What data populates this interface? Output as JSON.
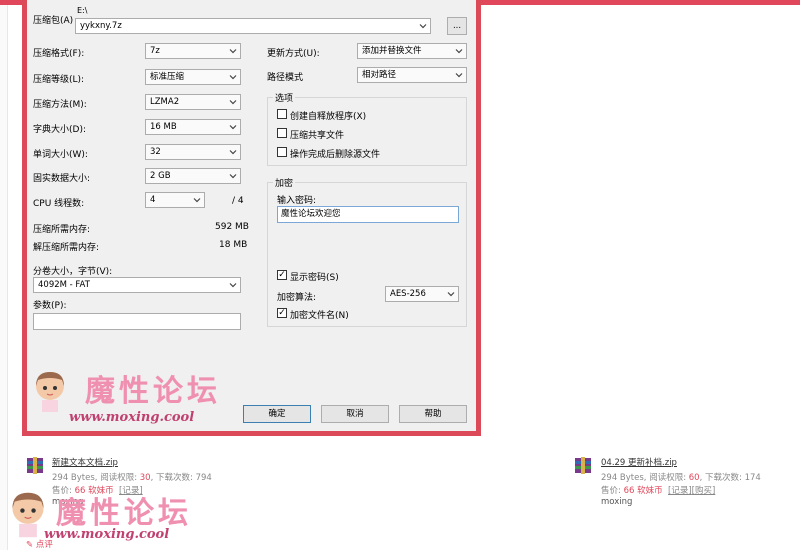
{
  "colors": {
    "accent": "#e0475a",
    "dialog_bg": "#f0f0f0",
    "watermark_pink": "#f090b0"
  },
  "archive": {
    "label": "压缩包(A)",
    "path_hint": "E:\\",
    "name_value": "yykxny.7z",
    "browse_label": "..."
  },
  "left": {
    "format": {
      "label": "压缩格式(F):",
      "value": "7z"
    },
    "level": {
      "label": "压缩等级(L):",
      "value": "标准压缩"
    },
    "method": {
      "label": "压缩方法(M):",
      "value": "LZMA2"
    },
    "dict": {
      "label": "字典大小(D):",
      "value": "16 MB"
    },
    "word": {
      "label": "单词大小(W):",
      "value": "32"
    },
    "solid": {
      "label": "固实数据大小:",
      "value": "2 GB"
    },
    "cpu": {
      "label": "CPU 线程数:",
      "value": "4",
      "total": "/ 4"
    },
    "mem_compress": {
      "label": "压缩所需内存:",
      "value": "592 MB"
    },
    "mem_decompress": {
      "label": "解压缩所需内存:",
      "value": "18 MB"
    },
    "volume": {
      "label": "分卷大小，字节(V):",
      "value": "4092M - FAT"
    },
    "params": {
      "label": "参数(P):",
      "value": ""
    }
  },
  "right": {
    "update": {
      "label": "更新方式(U):",
      "value": "添加并替换文件"
    },
    "path_mode": {
      "label": "路径模式",
      "value": "相对路径"
    },
    "options": {
      "title": "选项",
      "sfx": "创建自释放程序(X)",
      "shared": "压缩共享文件",
      "delete": "操作完成后删除源文件"
    },
    "encrypt": {
      "title": "加密",
      "pw_label": "输入密码:",
      "pw_value": "魔性论坛欢迎您",
      "show_pw": "显示密码(S)",
      "algo_label": "加密算法:",
      "algo_value": "AES-256",
      "enc_names": "加密文件名(N)"
    }
  },
  "buttons": {
    "ok": "确定",
    "cancel": "取消",
    "help": "帮助"
  },
  "watermark": {
    "title": "魔性论坛",
    "url": "www.moxing.cool"
  },
  "attachments": [
    {
      "name": "新建文本文档.zip",
      "size": "294 Bytes",
      "read_label": "阅读权限:",
      "read_value": "30",
      "downloads_label": "下载次数:",
      "downloads_value": "794",
      "price_label": "售价:",
      "price_value": "66 软妹币",
      "record": "[记录]",
      "buy": "",
      "uploader": "moxing"
    },
    {
      "name": "04.29 更新补档.zip",
      "size": "294 Bytes",
      "read_label": "阅读权限:",
      "read_value": "60",
      "downloads_label": "下载次数:",
      "downloads_value": "174",
      "price_label": "售价:",
      "price_value": "66 软妹币",
      "record": "[记录]",
      "buy": "[购买]",
      "uploader": "moxing"
    }
  ],
  "bottom_link": "点评"
}
